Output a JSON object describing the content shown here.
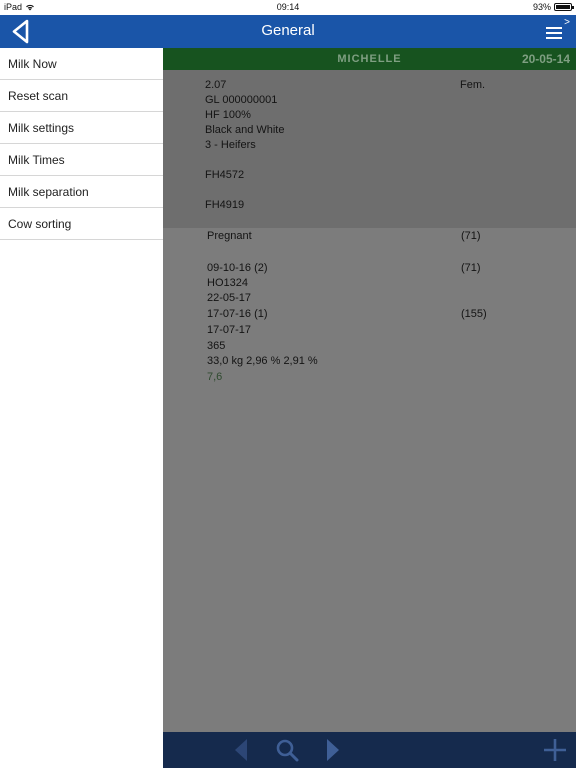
{
  "status": {
    "device": "iPad",
    "time": "09:14",
    "battery": "93%",
    "battery_level": 0.93
  },
  "nav": {
    "title": "General"
  },
  "menu": {
    "items": [
      {
        "label": "Milk Now"
      },
      {
        "label": "Reset scan"
      },
      {
        "label": "Milk settings"
      },
      {
        "label": "Milk Times"
      },
      {
        "label": "Milk separation"
      },
      {
        "label": "Cow sorting"
      }
    ]
  },
  "cow": {
    "name": "MICHELLE",
    "date": "20-05-14",
    "number": "2.07",
    "sex": "Fem.",
    "id": "GL 000000001",
    "breed_pct": "HF 100%",
    "color": "Black and White",
    "group": "3 - Heifers",
    "code1": "FH4572",
    "code2": "FH4919"
  },
  "details": {
    "status": "Pregnant",
    "status_days": "(71)",
    "insem_date": "09-10-16 (2)",
    "insem_days": "(71)",
    "bull": "HO1324",
    "expected": "22-05-17",
    "calving": "17-07-16 (1)",
    "calving_days": "(155)",
    "dry_date": "17-07-17",
    "lactation_days": "365",
    "yield": "33,0 kg 2,96 %  2,91 %",
    "extra": "7,6"
  },
  "colors": {
    "nav": "#1a55a8",
    "cowbar": "#17531f",
    "toolbar": "#152a4d"
  }
}
